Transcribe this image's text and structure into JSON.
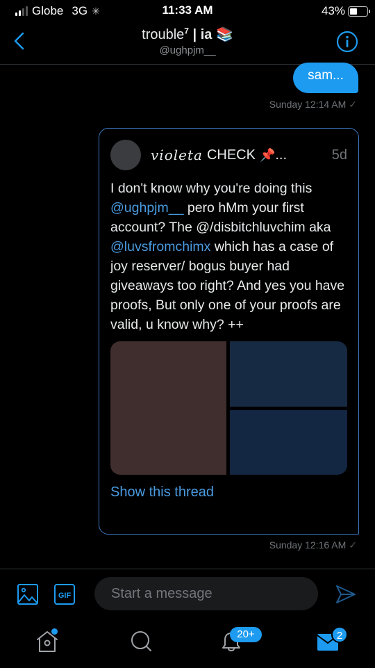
{
  "status_bar": {
    "carrier": "Globe",
    "network": "3G",
    "time": "11:33 AM",
    "battery_percent_label": "43%",
    "battery_level": 0.43
  },
  "header": {
    "title_main": "trouble",
    "title_superscript": "7",
    "title_separator": " | ",
    "title_suffix": "ia",
    "title_emoji": "📚",
    "handle": "@ughpjm__",
    "back_icon": "chevron-left-icon",
    "info_icon": "info-icon"
  },
  "messages": [
    {
      "type": "text",
      "text": "sam...",
      "timestamp": "Sunday 12:14 AM",
      "status": "✓"
    },
    {
      "type": "shared_tweet",
      "author_display_script": "violeta",
      "author_display_rest": "CHECK",
      "author_emoji": "📌",
      "author_ellipsis": "...",
      "age": "5d",
      "body": [
        {
          "text": "I don't know why you're doing this ",
          "mention": false
        },
        {
          "text": "@ughpjm__",
          "mention": true
        },
        {
          "text": " pero hMm your first account? The @/disbitchluvchim aka ",
          "mention": false
        },
        {
          "text": "@luvsfromchimx",
          "mention": true
        },
        {
          "text": " which has a case of joy reserver/ bogus buyer had giveaways too right? And yes you have proofs, But only one of your proofs are valid, u know why? ++",
          "mention": false
        }
      ],
      "media_count": 3,
      "media_colors": [
        "#402e2e",
        "#172a43",
        "#132642"
      ],
      "show_thread_label": "Show this thread",
      "timestamp": "Sunday 12:16 AM",
      "status": "✓"
    }
  ],
  "composer": {
    "placeholder": "Start a message",
    "value": "",
    "image_icon": "image-icon",
    "gif_label": "GIF",
    "send_icon": "send-icon"
  },
  "tabbar": {
    "home": {
      "icon": "home-icon",
      "has_dot": true
    },
    "search": {
      "icon": "search-icon"
    },
    "notifications": {
      "icon": "bell-icon",
      "badge": "20+"
    },
    "messages": {
      "icon": "mail-icon",
      "badge": "2"
    }
  },
  "colors": {
    "accent": "#1d9bf0",
    "link": "#4a9be0",
    "background": "#000000",
    "card_border": "#3d78c2"
  }
}
